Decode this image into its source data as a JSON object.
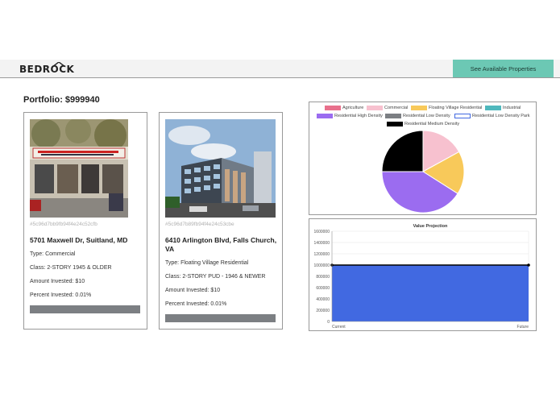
{
  "navbar": {
    "logo": "BEDROCK",
    "cta_label": "See Available Properties"
  },
  "portfolio": {
    "title": "Portfolio: $999940"
  },
  "cards": [
    {
      "id": "#5c96d7bb9fb94f4e24c52cfb",
      "address": "5701 Maxwell Dr, Suitland, MD",
      "type": "Type: Commercial",
      "class": "Class: 2-STORY 1945 & OLDER",
      "amount": "Amount Invested: $10",
      "percent": "Percent Invested: 0.01%",
      "progress": 0.0001
    },
    {
      "id": "#5c96d7b89fb94f4e24c53cbe",
      "address_line1": "6410 Arlington Blvd, Falls Church,",
      "address_line2": "VA",
      "type": "Type: Floating Village Residential",
      "class": "Class: 2-STORY PUD - 1946 & NEWER",
      "amount": "Amount Invested: $10",
      "percent": "Percent Invested: 0.01%",
      "progress": 0.0001
    }
  ],
  "chart_data": [
    {
      "type": "pie",
      "legend": [
        {
          "label": "Agriculture",
          "color": "#e8708c"
        },
        {
          "label": "Commercial",
          "color": "#f7c1cf"
        },
        {
          "label": "Floating Village Residential",
          "color": "#f8c95a"
        },
        {
          "label": "Industrial",
          "color": "#4fb8bd"
        },
        {
          "label": "Residential High Density",
          "color": "#9b6cf0"
        },
        {
          "label": "Residential Low Density",
          "color": "#7c7f83"
        },
        {
          "label": "Residential Low Density Park",
          "color": "#ffffff"
        },
        {
          "label": "Residential Medium Density",
          "color": "#000000"
        }
      ],
      "slices": [
        {
          "label": "Commercial",
          "value": 17,
          "color": "#f7c1cf"
        },
        {
          "label": "Floating Village Residential",
          "value": 17,
          "color": "#f8c95a"
        },
        {
          "label": "Residential High Density",
          "value": 41,
          "color": "#9b6cf0"
        },
        {
          "label": "Residential Medium Density",
          "value": 25,
          "color": "#000000"
        }
      ],
      "legend_position": "top"
    },
    {
      "type": "area",
      "title": "Value Projection",
      "categories": [
        "Current",
        "Future"
      ],
      "values": [
        999940,
        999940
      ],
      "ylim": [
        0,
        1600000
      ],
      "yticks": [
        "0",
        "200000",
        "400000",
        "600000",
        "800000",
        "1000000",
        "1200000",
        "1400000",
        "1600000"
      ],
      "fill_color": "#4169e1",
      "line_color": "#000000",
      "grid": true
    }
  ]
}
